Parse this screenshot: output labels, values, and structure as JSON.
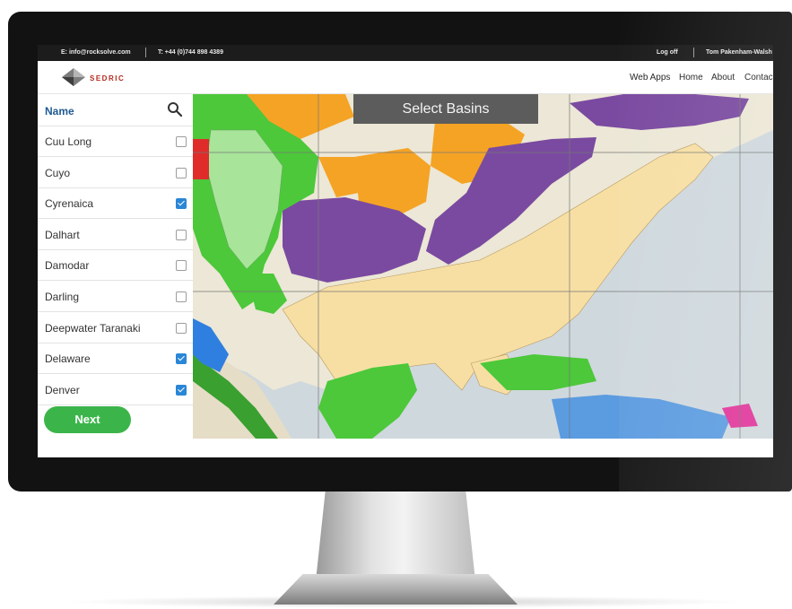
{
  "topbar": {
    "email": "E: info@rocksolve.com",
    "phone": "T: +44 (0)744 898 4389",
    "logoff": "Log off",
    "user": "Tom Pakenham-Walsh"
  },
  "brand": {
    "name": "SEDRIC"
  },
  "nav": {
    "items": [
      "Web Apps",
      "Home",
      "About",
      "Contact"
    ]
  },
  "sidebar": {
    "header": "Name",
    "search_icon": "search-icon",
    "items": [
      {
        "label": "Cuu Long",
        "checked": false
      },
      {
        "label": "Cuyo",
        "checked": false
      },
      {
        "label": "Cyrenaica",
        "checked": true
      },
      {
        "label": "Dalhart",
        "checked": false
      },
      {
        "label": "Damodar",
        "checked": false
      },
      {
        "label": "Darling",
        "checked": false
      },
      {
        "label": "Deepwater Taranaki",
        "checked": false
      },
      {
        "label": "Delaware",
        "checked": true
      },
      {
        "label": "Denver",
        "checked": true
      }
    ],
    "next_label": "Next"
  },
  "map": {
    "title": "Select Basins",
    "colors": {
      "land": "#ece7d6",
      "ocean": "#cfd8dd",
      "basin_tan": "#f7dfa4",
      "basin_orange": "#f5a324",
      "basin_purple": "#7a4aa0",
      "basin_green": "#4cc83a",
      "basin_lightgreen": "#a8e49a",
      "basin_blue": "#2f7fe0",
      "basin_red": "#e02b2b",
      "basin_pink": "#e0359a"
    }
  },
  "accent": {
    "link": "#1f5a92",
    "button": "#3bb54a",
    "checkbox": "#2a86d6"
  }
}
